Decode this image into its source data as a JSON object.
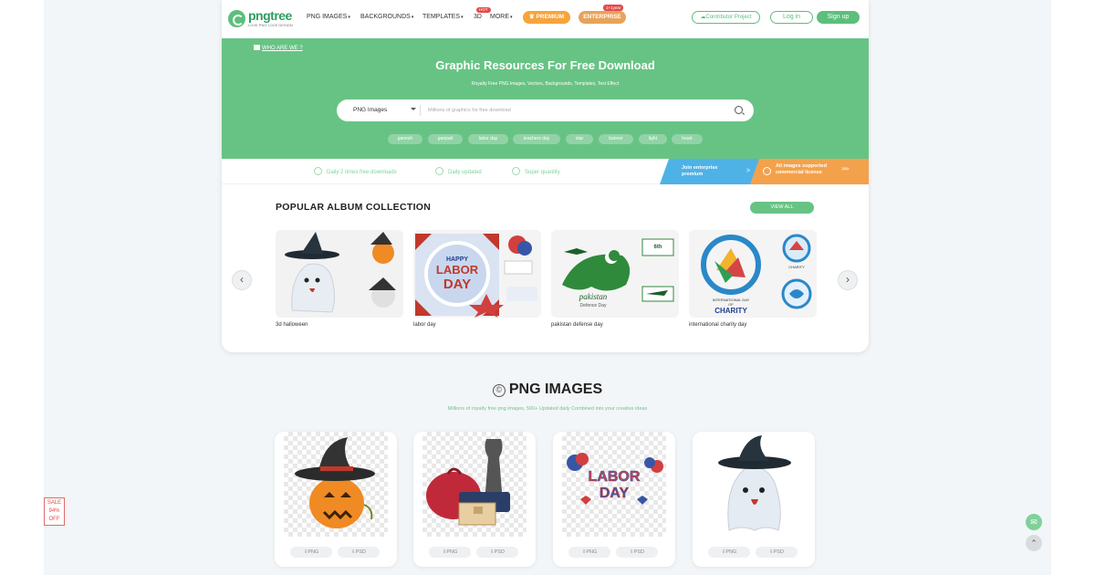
{
  "header": {
    "logo_text": "pngtree",
    "logo_sub": "LOVE PNG LOVE DESIGN",
    "nav": [
      {
        "label": "PNG IMAGES"
      },
      {
        "label": "BACKGROUNDS"
      },
      {
        "label": "TEMPLATES"
      },
      {
        "label": "3D"
      },
      {
        "label": "MORE"
      }
    ],
    "hot_badge": "HOT",
    "premium_label": "PREMIUM",
    "enterprise_label": "ENTERPRISE",
    "enterprise_badge": "1+1year",
    "contributor_label": "Contributor Project",
    "login_label": "Log in",
    "signup_label": "Sign up"
  },
  "hero": {
    "who_are_we": "WHO ARE WE",
    "who_suffix": "?",
    "title": "Graphic Resources For Free Download",
    "subtitle": "Royalty Free PNG Images, Vectors, Backgrounds, Templates, Text Effect",
    "search": {
      "category": "PNG Images",
      "placeholder": "Millions of graphics for free download"
    },
    "tags": [
      "ganesh",
      "ganpati",
      "labor day",
      "teachers day",
      "star",
      "banner",
      "light",
      "heart"
    ]
  },
  "features": {
    "items": [
      "Daily 2 times free downloads",
      "Daily updated",
      "Super quantity"
    ],
    "join_enterprise": "Join enterprise premium",
    "join_arrow": ">",
    "all_images": "All images supported commercial license",
    "all_arrow": ">>>"
  },
  "albums": {
    "title": "POPULAR ALBUM COLLECTION",
    "view_all": "VIEW ALL",
    "items": [
      {
        "label": "3d halloween"
      },
      {
        "label": "labor day"
      },
      {
        "label": "pakistan defense day"
      },
      {
        "label": "international charity day"
      }
    ],
    "prev_arrow": "‹",
    "next_arrow": "›",
    "art_text": {
      "labor_day_lines": [
        "HAPPY",
        "LABOR",
        "DAY"
      ],
      "pakistan_lines": [
        "pakistan",
        "Defence Day"
      ],
      "pakistan_badge": "6th",
      "charity_lines": [
        "INTERNATIONAL DAY",
        "OF",
        "CHARITY"
      ],
      "charity_small": "CHARITY"
    }
  },
  "png_section": {
    "title": "PNG IMAGES",
    "title_icon": "©",
    "subtitle": "Millions of royalty free png images, 500+ Updated daily Combined into your creative ideas",
    "tiles": [
      {
        "png": "PNG",
        "psd": "PSD"
      },
      {
        "png": "PNG",
        "psd": "PSD"
      },
      {
        "png": "PNG",
        "psd": "PSD",
        "art_lines": [
          "LABOR",
          "DAY"
        ]
      },
      {
        "png": "PNG",
        "psd": "PSD"
      }
    ]
  },
  "side": {
    "sale": [
      "SALE",
      "94%",
      "OFF"
    ]
  },
  "colors": {
    "brand_green": "#67c384",
    "premium_orange": "#f7a43a",
    "enterprise_blue": "#4fb2e6"
  }
}
